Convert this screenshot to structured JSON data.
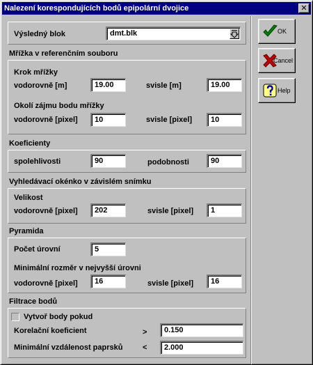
{
  "window": {
    "title": "Nalezení korespondujících bodů epipolární dvojice",
    "close_glyph": "✕"
  },
  "buttons": {
    "ok": {
      "label": "OK",
      "icon": "check-icon"
    },
    "cancel": {
      "label": "Cancel",
      "icon": "x-icon"
    },
    "help": {
      "label": "Help",
      "icon": "question-icon"
    }
  },
  "result_block": {
    "label": "Výsledný blok",
    "value": "dmt.blk",
    "icon": "dropdown-arrow-icon"
  },
  "grid": {
    "title": "Mřížka v referenčním souboru",
    "step_label": "Krok mřížky",
    "horizontal_m_label": "vodorovně [m]",
    "horizontal_m_value": "19.00",
    "vertical_m_label": "svisle [m]",
    "vertical_m_value": "19.00",
    "neighborhood_label": "Okolí zájmu bodu mřížky",
    "horizontal_px_label": "vodorovně [pixel]",
    "horizontal_px_value": "10",
    "vertical_px_label": "svisle [pixel]",
    "vertical_px_value": "10"
  },
  "coefficients": {
    "title": "Koeficienty",
    "reliability_label": "spolehlivosti",
    "reliability_value": "90",
    "similarity_label": "podobnosti",
    "similarity_value": "90"
  },
  "search_window": {
    "title": "Vyhledávací okénko v závislém snímku",
    "size_label": "Velikost",
    "horizontal_px_label": "vodorovně [pixel]",
    "horizontal_px_value": "202",
    "vertical_px_label": "svisle [pixel]",
    "vertical_px_value": "1"
  },
  "pyramid": {
    "title": "Pyramida",
    "levels_label": "Počet úrovní",
    "levels_value": "5",
    "min_size_label": "Minimální rozměr v nejvyšší úrovni",
    "horizontal_px_label": "vodorovně [pixel]",
    "horizontal_px_value": "16",
    "vertical_px_label": "svisle [pixel]",
    "vertical_px_value": "16"
  },
  "filter": {
    "title": "Filtrace bodů",
    "create_points_label": "Vytvoř body pokud",
    "correlation_label": "Korelační koeficient",
    "correlation_op": ">",
    "correlation_value": "0.150",
    "min_distance_label": "Minimální vzdálenost paprsků",
    "min_distance_op": "<",
    "min_distance_value": "2.000"
  }
}
